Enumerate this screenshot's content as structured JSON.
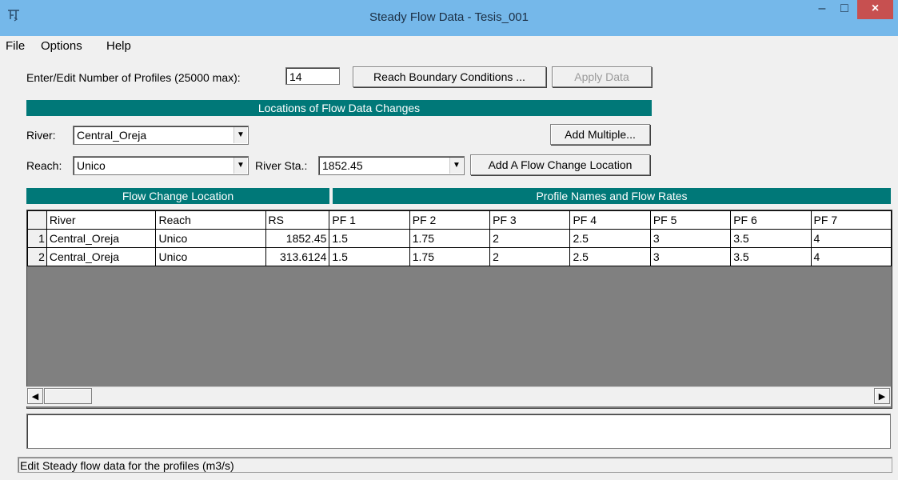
{
  "window": {
    "title": "Steady Flow Data - Tesis_001",
    "controls": {
      "minimize": "–",
      "maximize": "□",
      "close": "×"
    }
  },
  "menu": [
    "File",
    "Options",
    "Help"
  ],
  "profiles": {
    "label": "Enter/Edit Number of Profiles (25000 max):",
    "value": "14"
  },
  "buttons": {
    "reach_boundary": "Reach Boundary Conditions ...",
    "apply_data": "Apply Data",
    "add_multiple": "Add Multiple...",
    "add_flow_change": "Add A Flow Change Location"
  },
  "locations_header": "Locations of Flow Data Changes",
  "river": {
    "label": "River:",
    "value": "Central_Oreja"
  },
  "reach": {
    "label": "Reach:",
    "value": "Unico"
  },
  "river_sta": {
    "label": "River Sta.:",
    "value": "1852.45"
  },
  "grid": {
    "group_left": "Flow Change Location",
    "group_right": "Profile Names and Flow Rates",
    "columns": [
      "River",
      "Reach",
      "RS",
      "PF 1",
      "PF 2",
      "PF 3",
      "PF 4",
      "PF 5",
      "PF 6",
      "PF 7"
    ],
    "rows": [
      {
        "num": "1",
        "cells": [
          "Central_Oreja",
          "Unico",
          "1852.45",
          "1.5",
          "1.75",
          "2",
          "2.5",
          "3",
          "3.5",
          "4"
        ]
      },
      {
        "num": "2",
        "cells": [
          "Central_Oreja",
          "Unico",
          "313.6124",
          "1.5",
          "1.75",
          "2",
          "2.5",
          "3",
          "3.5",
          "4"
        ]
      }
    ]
  },
  "scroll": {
    "left": "◀",
    "right": "▶"
  },
  "status": "Edit Steady flow data for the profiles (m3/s)",
  "icons": {
    "app": "hecras-flow-icon",
    "combo_arrow": "▼"
  },
  "colors": {
    "teal_header": "#007878",
    "title_bar": "#75b8ea",
    "close": "#c75050"
  }
}
